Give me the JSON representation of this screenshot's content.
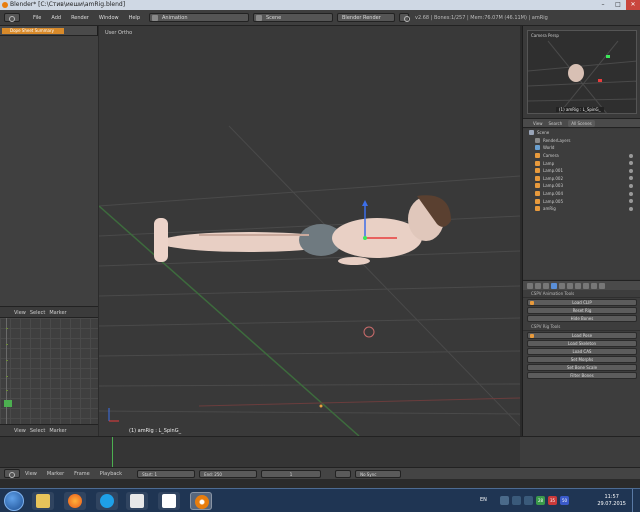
{
  "window": {
    "title": "Blender* [C:\\Стив\\иеши\\amRig.blend]",
    "minimize": "–",
    "maximize": "□",
    "close": "✕"
  },
  "menubar": {
    "menus": [
      "File",
      "Add",
      "Render",
      "Window",
      "Help"
    ],
    "layout": "Animation",
    "scene": "Scene",
    "engine": "Blender Render",
    "stats": "v2.68 | Bones:1/257 | Mem:76.07M (46.11M) | amRig"
  },
  "dopesheet": {
    "label": "Dope Sheet Summary"
  },
  "graph_header": {
    "menus": [
      "View",
      "Select",
      "Marker"
    ]
  },
  "graph_footer": {
    "menus": [
      "View",
      "Select",
      "Marker"
    ]
  },
  "viewport": {
    "label": "User Ortho",
    "object_label": "(1) amRig : L_SpinG_"
  },
  "camera_preview": {
    "label": "Camera Persp",
    "footer": "(1) amRig : L_SpinG_"
  },
  "outliner": {
    "tabs": [
      "View",
      "Search",
      "All Scenes"
    ],
    "rows": [
      {
        "label": "Scene",
        "color": "#9aa5b8"
      },
      {
        "label": "RenderLayers",
        "color": "#8a8a8a"
      },
      {
        "label": "World",
        "color": "#6aa0d0"
      },
      {
        "label": "Camera",
        "color": "#e89a3c"
      },
      {
        "label": "Lamp",
        "color": "#e89a3c"
      },
      {
        "label": "Lamp.001",
        "color": "#e89a3c"
      },
      {
        "label": "Lamp.002",
        "color": "#e89a3c"
      },
      {
        "label": "Lamp.003",
        "color": "#e89a3c"
      },
      {
        "label": "Lamp.004",
        "color": "#e89a3c"
      },
      {
        "label": "Lamp.005",
        "color": "#e89a3c"
      },
      {
        "label": "amRig",
        "color": "#e89a3c"
      }
    ]
  },
  "properties": {
    "section1": "CSPV Animation Tools",
    "buttons1": [
      "Load CLIP",
      "Reset Rig",
      "Hide Bones"
    ],
    "section2": "CSPV Rig Tools",
    "buttons2": [
      "Load Pose",
      "Load Skeleton",
      "Load CAS",
      "Set Morphs",
      "Set Bone Scale",
      "Filter Bones"
    ]
  },
  "timeline": {
    "menus": [
      "View",
      "Marker",
      "Frame",
      "Playback"
    ],
    "start": "Start: 1",
    "end": "End: 250",
    "current": "1",
    "sync": "No Sync"
  },
  "taskbar": {
    "lang": "EN",
    "time": "11:57",
    "date": "29.07.2015",
    "badges": [
      "28",
      "35",
      "50"
    ]
  }
}
